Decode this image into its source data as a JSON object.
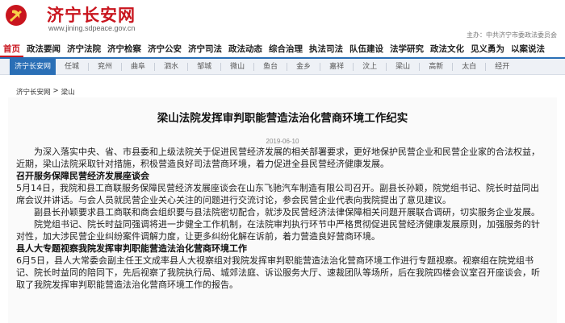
{
  "colors": {
    "brand_red": "#c9151e",
    "nav_blue": "#2a6fb6",
    "county_bar_bg": "#eef1f6"
  },
  "header": {
    "emblem_icon": "party-emblem-icon",
    "site_name": "济宁长安网",
    "site_url": "www.jining.sdpeace.gov.cn",
    "host": "主办：中共济宁市委政法委员会"
  },
  "main_nav": {
    "items": [
      "首页",
      "政法要闻",
      "济宁法院",
      "济宁检察",
      "济宁公安",
      "济宁司法",
      "政法动态",
      "综合治理",
      "执法司法",
      "队伍建设",
      "法学研究",
      "政法文化",
      "见义勇为",
      "以案说法"
    ],
    "active_index": 0
  },
  "county_bar": {
    "active": "济宁长安网",
    "items": [
      "任城",
      "兖州",
      "曲阜",
      "泗水",
      "邹城",
      "微山",
      "鱼台",
      "金乡",
      "嘉祥",
      "汶上",
      "梁山",
      "高新",
      "太白",
      "经开"
    ]
  },
  "breadcrumb": {
    "home": "济宁长安网",
    "sep": ">",
    "current": "梁山"
  },
  "article": {
    "title": "梁山法院发挥审判职能营造法治化营商环境工作纪实",
    "date": "2019-06-10",
    "p1": "为深入落实中央、省、市县委和上级法院关于促进民营经济发展的相关部署要求，更好地保护民营企业和民营企业家的合法权益，近期，梁山法院采取针对措施，积极营造良好司法营商环境，着力促进全县民营经济健康发展。",
    "h1": "召开服务保障民营经济发展座谈会",
    "p2": "5月14日，我院和县工商联服务保障民营经济发展座谈会在山东飞驰汽车制造有限公司召开。副县长孙颖，院党组书记、院长时益同出席会议并讲话。与会人员就民营企业关心关注的问题进行交流讨论，参会民营企业代表向我院提出了意见建议。",
    "p3": "副县长孙颖要求县工商联和商会组织要与县法院密切配合，就涉及民营经济法律保障相关问题开展联合调研，切实服务企业发展。",
    "p4": "院党组书记、院长时益同强调将进一步健全工作机制，在法院审判执行环节中严格贯彻促进民营经济健康发展原则，加强服务的针对性，加大涉民营企业纠纷案件调解力度，让更多纠纷化解在诉前，着力营造良好营商环境。",
    "h2": "县人大专题视察我院发挥审判职能营造法治化营商环境工作",
    "p5": "6月5日，县人大常委会副主任王文成率县人大视察组对我院发挥审判职能营造法治化营商环境工作进行专题视察。视察组在院党组书记、院长时益同的陪同下，先后视察了我院执行局、城郊法庭、诉讼服务大厅、速裁团队等场所，后在我院四楼会议室召开座谈会，听取了我院发挥审判职能营造法治化营商环境工作的报告。"
  }
}
